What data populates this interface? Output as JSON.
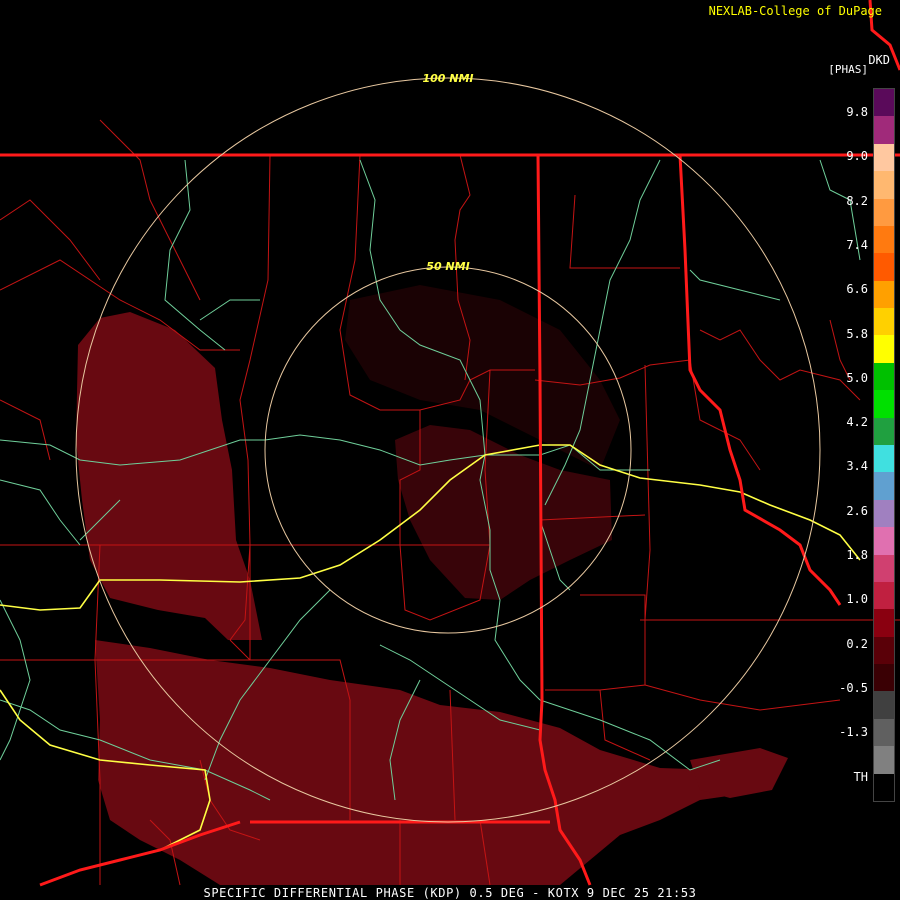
{
  "header": {
    "credit": "NEXLAB-College of DuPage",
    "site": "DKD",
    "product_label": "[PHAS]"
  },
  "footer": {
    "caption": "SPECIFIC DIFFERENTIAL PHASE (KDP) 0.5 DEG - KOTX 9 DEC 25 21:53"
  },
  "range_rings": {
    "inner_label": "50 NMI",
    "outer_label": "100 NMI"
  },
  "colors": {
    "background": "#000000",
    "echo": "#7a0a14",
    "county_lines": "#cc1a1a",
    "state_lines": "#ff1a1a",
    "highways": "#6fcf9a",
    "interstates": "#ffff44",
    "range_rings": "#e8c8a0"
  },
  "color_scale": {
    "ticks": [
      "9.8",
      "9.0",
      "8.2",
      "7.4",
      "6.6",
      "5.8",
      "5.0",
      "4.2",
      "3.4",
      "2.6",
      "1.8",
      "1.0",
      "0.2",
      "-0.5",
      "-1.3",
      "TH"
    ],
    "bands": [
      {
        "color": "#5a0a5a"
      },
      {
        "color": "#a02a7a"
      },
      {
        "color": "#ffc8a0"
      },
      {
        "color": "#ffb870"
      },
      {
        "color": "#ff9a40"
      },
      {
        "color": "#ff7a10"
      },
      {
        "color": "#ff5a00"
      },
      {
        "color": "#ffa000"
      },
      {
        "color": "#ffd000"
      },
      {
        "color": "#ffff00"
      },
      {
        "color": "#00c000"
      },
      {
        "color": "#00e000"
      },
      {
        "color": "#20a040"
      },
      {
        "color": "#40e0e0"
      },
      {
        "color": "#60a0d0"
      },
      {
        "color": "#a080c0"
      },
      {
        "color": "#e070b0"
      },
      {
        "color": "#d04070"
      },
      {
        "color": "#c02040"
      },
      {
        "color": "#8a0010"
      },
      {
        "color": "#5a0008"
      },
      {
        "color": "#3a0004"
      },
      {
        "color": "#404040"
      },
      {
        "color": "#606060"
      },
      {
        "color": "#808080"
      },
      {
        "color": "#000000"
      }
    ]
  }
}
